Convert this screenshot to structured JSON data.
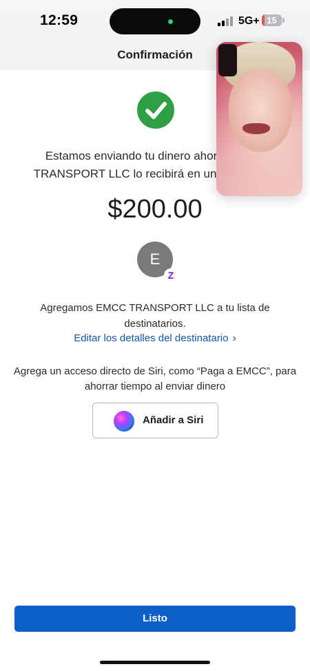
{
  "status_bar": {
    "time": "12:59",
    "network": "5G+",
    "battery": "15",
    "battery_level": 0.15
  },
  "header": {
    "title": "Confirmación"
  },
  "confirmation": {
    "message": "Estamos enviando tu dinero ahora. EMCC TRANSPORT LLC lo recibirá en unos minutos.",
    "amount": "$200.00"
  },
  "recipient": {
    "avatar_initial": "E",
    "badge": "Z",
    "added_text": "Agregamos EMCC TRANSPORT LLC a tu lista de destinatarios.",
    "edit_link": "Editar los detalles del destinatario",
    "chevron": "›"
  },
  "siri": {
    "text": "Agrega un acceso directo de Siri, como “Paga a EMCC”, para ahorrar tiempo al enviar dinero",
    "button_label": "Añadir a Siri"
  },
  "footer": {
    "done_label": "Listo"
  },
  "colors": {
    "success": "#2ea043",
    "link": "#1457a6",
    "primary_button": "#0b5fc6",
    "zelle": "#6d1ed4"
  }
}
